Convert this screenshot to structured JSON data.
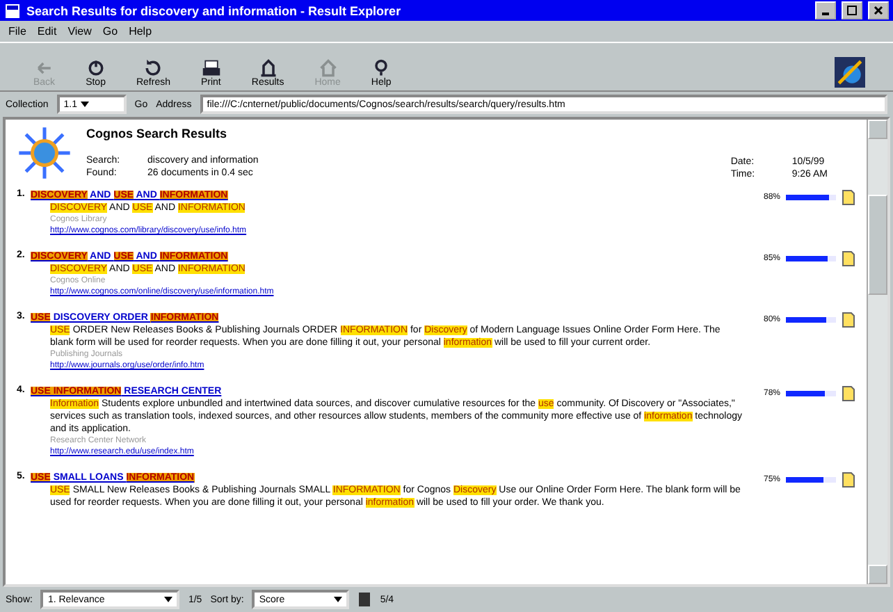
{
  "window": {
    "title": "Search Results for discovery and information - Result Explorer"
  },
  "menu": [
    "File",
    "Edit",
    "View",
    "Go",
    "Help"
  ],
  "toolbar": [
    {
      "label": "Back",
      "disabled": true
    },
    {
      "label": "Stop",
      "disabled": false
    },
    {
      "label": "Refresh",
      "disabled": false
    },
    {
      "label": "Print",
      "disabled": false
    },
    {
      "label": "Results",
      "disabled": false
    },
    {
      "label": "Home",
      "disabled": true
    },
    {
      "label": "Help",
      "disabled": false
    }
  ],
  "address_bar": {
    "collection_label": "Collection",
    "collection": "1.1",
    "go": "Go",
    "address_label": "Address",
    "url": "file:///C:/cnternet/public/documents/Cognos/search/results/search/query/results.htm"
  },
  "header": {
    "title": "Cognos Search Results",
    "query_label": "Search:",
    "query": "discovery and information",
    "found_label": "Found:",
    "found": "26 documents in 0.4 sec",
    "date_label": "Date:",
    "date": "10/5/99",
    "time_label": "Time:",
    "time": "9:26 AM"
  },
  "results": [
    {
      "number": "1.",
      "title": [
        {
          "text": "DISCOVERY",
          "highlight": true
        },
        {
          "text": " AND ",
          "highlight": false
        },
        {
          "text": "USE",
          "highlight": true
        },
        {
          "text": " AND ",
          "highlight": false
        },
        {
          "text": "INFORMATION",
          "highlight": true
        }
      ],
      "summary": [
        {
          "text": "DISCOVERY",
          "highlight": true
        },
        {
          "text": " AND ",
          "highlight": false
        },
        {
          "text": "USE",
          "highlight": true
        },
        {
          "text": " AND ",
          "highlight": false
        },
        {
          "text": "INFORMATION",
          "highlight": true
        }
      ],
      "meta": "Cognos Library",
      "url": "http://www.cognos.com/library/discovery/use/info.htm",
      "score": "88%",
      "level": 0.85
    },
    {
      "number": "2.",
      "title": [
        {
          "text": "DISCOVERY",
          "highlight": true
        },
        {
          "text": " AND ",
          "highlight": false
        },
        {
          "text": "USE",
          "highlight": true
        },
        {
          "text": " AND ",
          "highlight": false
        },
        {
          "text": "INFORMATION",
          "highlight": true
        }
      ],
      "summary": [
        {
          "text": "DISCOVERY",
          "highlight": true
        },
        {
          "text": " AND ",
          "highlight": false
        },
        {
          "text": "USE",
          "highlight": true
        },
        {
          "text": " AND ",
          "highlight": false
        },
        {
          "text": "INFORMATION",
          "highlight": true
        }
      ],
      "meta": "Cognos Online",
      "url": "http://www.cognos.com/online/discovery/use/information.htm",
      "score": "85%",
      "level": 0.82
    },
    {
      "number": "3.",
      "title": [
        {
          "text": "USE",
          "highlight": true
        },
        {
          "text": " DISCOVERY ORDER ",
          "highlight": false
        },
        {
          "text": "INFORMATION",
          "highlight": true
        }
      ],
      "summary": [
        {
          "text": "USE",
          "highlight": true
        },
        {
          "text": " ORDER New Releases Books & Publishing Journals ORDER ",
          "highlight": false
        },
        {
          "text": "INFORMATION",
          "highlight": true
        },
        {
          "text": " for ",
          "highlight": false
        },
        {
          "text": "Discovery",
          "highlight": true
        },
        {
          "text": " of Modern Language Issues Online Order Form Here. The blank form will be used for reorder requests. When you are done filling it out, your personal ",
          "highlight": false
        },
        {
          "text": "information",
          "highlight": true
        },
        {
          "text": " will be used to fill your current order.",
          "highlight": false
        }
      ],
      "meta": "Publishing Journals",
      "url": "http://www.journals.org/use/order/info.htm",
      "score": "80%",
      "level": 0.8
    },
    {
      "number": "4.",
      "title": [
        {
          "text": "USE INFORMATION",
          "highlight": true
        },
        {
          "text": " RESEARCH CENTER",
          "highlight": false
        }
      ],
      "summary": [
        {
          "text": "Information",
          "highlight": true
        },
        {
          "text": " Students explore unbundled and intertwined data sources, and discover cumulative resources for the ",
          "highlight": false
        },
        {
          "text": "use",
          "highlight": true
        },
        {
          "text": " community. Of Discovery or \"Associates,\" services such as translation tools, indexed sources, and other resources allow students, members of the community more effective use of ",
          "highlight": false
        },
        {
          "text": "information",
          "highlight": true
        },
        {
          "text": " technology and its application.",
          "highlight": false
        }
      ],
      "meta": "Research Center Network",
      "url": "http://www.research.edu/use/index.htm",
      "score": "78%",
      "level": 0.78
    },
    {
      "number": "5.",
      "title": [
        {
          "text": "USE",
          "highlight": true
        },
        {
          "text": " SMALL LOANS ",
          "highlight": false
        },
        {
          "text": "INFORMATION",
          "highlight": true
        }
      ],
      "summary": [
        {
          "text": "USE",
          "highlight": true
        },
        {
          "text": " SMALL New Releases Books & Publishing Journals SMALL ",
          "highlight": false
        },
        {
          "text": "INFORMATION",
          "highlight": true
        },
        {
          "text": " for Cognos ",
          "highlight": false
        },
        {
          "text": "Discovery",
          "highlight": true
        },
        {
          "text": " Use our Online Order Form Here. The blank form will be used for reorder requests. When you are done filling it out, your personal ",
          "highlight": false
        },
        {
          "text": "information",
          "highlight": true
        },
        {
          "text": " will be used to fill your order. We thank you.",
          "highlight": false
        }
      ],
      "score": "75%",
      "level": 0.76
    }
  ],
  "status_bar": {
    "show_label": "Show:",
    "show": "1. Relevance",
    "pages": "1/5",
    "sort_label": "Sort by:",
    "sort": "Score",
    "count": "5/4"
  }
}
